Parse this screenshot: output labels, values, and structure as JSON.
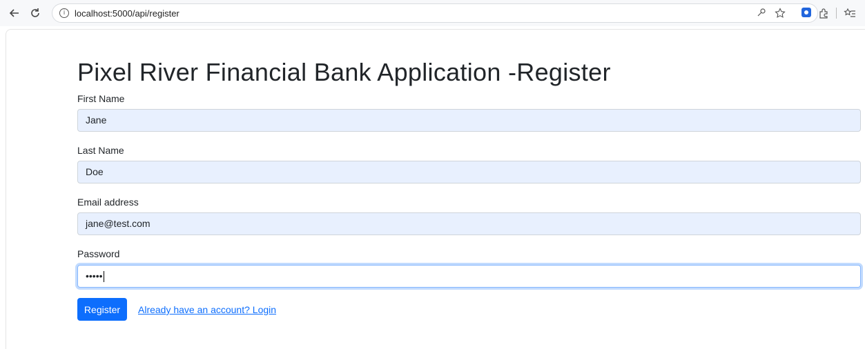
{
  "browser": {
    "url": "localhost:5000/api/register",
    "info_glyph": "i",
    "icons": [
      "back-arrow-icon",
      "reload-icon",
      "info-icon",
      "key-icon",
      "star-icon",
      "extension-icon",
      "extensions-puzzle-icon",
      "favorites-icon"
    ]
  },
  "page": {
    "title": "Pixel River Financial Bank Application -Register",
    "fields": [
      {
        "label": "First Name",
        "value": "Jane"
      },
      {
        "label": "Last Name",
        "value": "Doe"
      },
      {
        "label": "Email address",
        "value": "jane@test.com"
      },
      {
        "label": "Password",
        "value": "•••••"
      }
    ],
    "register_label": "Register",
    "login_link": "Already have an account? Login"
  },
  "colors": {
    "primary": "#0d6efd",
    "autofill_bg": "#e8f0fe",
    "text": "#212529"
  }
}
